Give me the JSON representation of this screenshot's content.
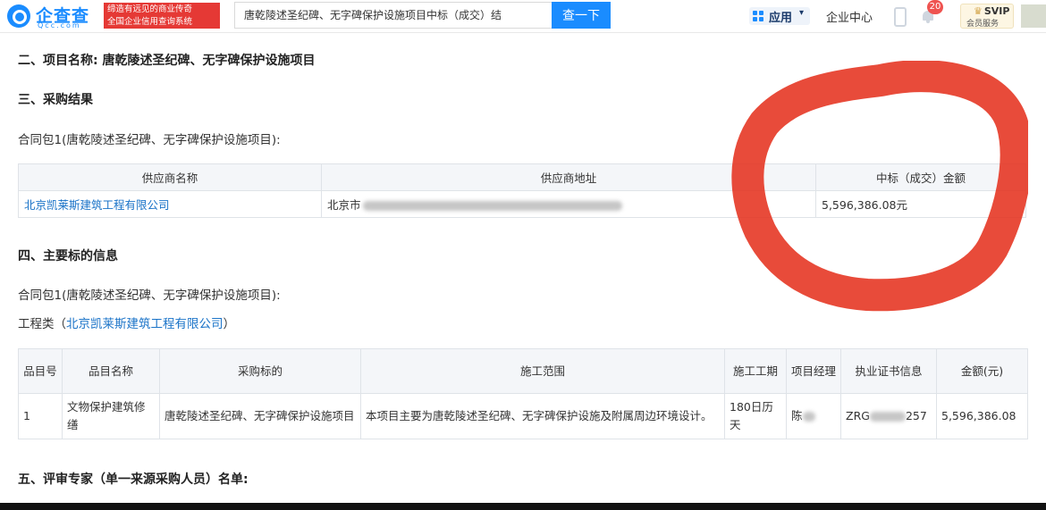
{
  "header": {
    "logo_name": "企查查",
    "logo_domain": "Qcc.com",
    "slogan_line1": "缔造有远见的商业传奇",
    "slogan_line2": "全国企业信用查询系统",
    "search_value": "唐乾陵述圣纪碑、无字碑保护设施项目中标（成交）结",
    "search_button": "查一下",
    "apps_label": "应用",
    "enterprise_center": "企业中心",
    "notif_count": "20",
    "svip_label": "SVIP",
    "svip_sub": "会员服务"
  },
  "sections": {
    "s2": "二、项目名称: 唐乾陵述圣纪碑、无字碑保护设施项目",
    "s3": "三、采购结果",
    "package": "合同包1(唐乾陵述圣纪碑、无字碑保护设施项目):",
    "s4": "四、主要标的信息",
    "package2": "合同包1(唐乾陵述圣纪碑、无字碑保护设施项目):",
    "category_prefix": "工程类（",
    "category_company": "北京凯莱斯建筑工程有限公司",
    "category_suffix": "）",
    "s5": "五、评审专家（单一来源采购人员）名单:"
  },
  "result_table": {
    "headers": [
      "供应商名称",
      "供应商地址",
      "中标（成交）金额"
    ],
    "row": {
      "supplier": "北京凯莱斯建筑工程有限公司",
      "address_visible": "北京市",
      "amount": "5,596,386.08元"
    }
  },
  "items_table": {
    "headers": [
      "品目号",
      "品目名称",
      "采购标的",
      "施工范围",
      "施工工期",
      "项目经理",
      "执业证书信息",
      "金额(元)"
    ],
    "row": {
      "no": "1",
      "category": "文物保护建筑修缮",
      "subject": "唐乾陵述圣纪碑、无字碑保护设施项目",
      "scope": "本项目主要为唐乾陵述圣纪碑、无字碑保护设施及附属周边环境设计。",
      "duration": "180日历天",
      "manager_visible": "陈",
      "cert_prefix": "ZRG",
      "cert_suffix": "257",
      "amount": "5,596,386.08"
    }
  },
  "colors": {
    "brand": "#1a8cff",
    "link": "#1a73c8",
    "annotation_red": "#e5321f"
  }
}
